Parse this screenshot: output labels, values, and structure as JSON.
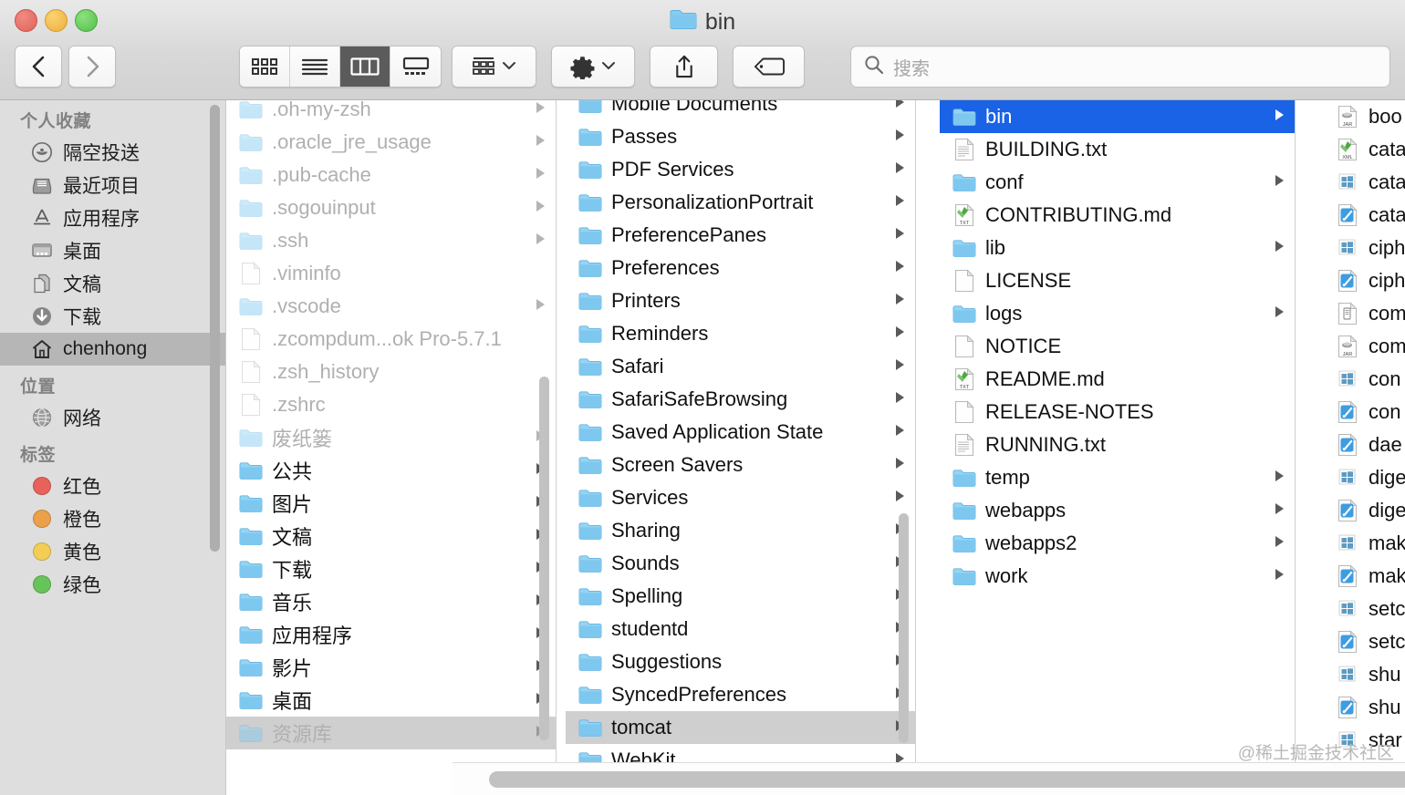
{
  "window": {
    "title": "bin",
    "title_icon": "folder-icon",
    "traffic_lights": [
      "close-button",
      "minimize-button",
      "zoom-button"
    ]
  },
  "toolbar": {
    "back_label": "‹",
    "forward_label": "›",
    "view_modes": [
      {
        "name": "icon-view",
        "label": "icon",
        "active": false
      },
      {
        "name": "list-view",
        "label": "list",
        "active": false
      },
      {
        "name": "column-view",
        "label": "column",
        "active": true
      },
      {
        "name": "gallery-view",
        "label": "gallery",
        "active": false
      }
    ],
    "arrange_label": "arrange",
    "action_label": "action",
    "share_label": "share",
    "tag_label": "tag",
    "chevron": "˅"
  },
  "search": {
    "placeholder": "搜索",
    "value": "",
    "icon": "search-icon"
  },
  "sidebar": {
    "sections": [
      {
        "title": "个人收藏",
        "items": [
          {
            "label": "隔空投送",
            "icon": "airdrop-icon",
            "selected": false
          },
          {
            "label": "最近项目",
            "icon": "recents-icon",
            "selected": false
          },
          {
            "label": "应用程序",
            "icon": "applications-icon",
            "selected": false
          },
          {
            "label": "桌面",
            "icon": "desktop-icon",
            "selected": false
          },
          {
            "label": "文稿",
            "icon": "documents-icon",
            "selected": false
          },
          {
            "label": "下载",
            "icon": "downloads-icon",
            "selected": false
          },
          {
            "label": "chenhong",
            "icon": "home-icon",
            "selected": true
          }
        ]
      },
      {
        "title": "位置",
        "items": [
          {
            "label": "网络",
            "icon": "network-icon",
            "selected": false
          }
        ]
      },
      {
        "title": "标签",
        "items": [
          {
            "label": "红色",
            "icon": "tag-dot-icon",
            "color": "#e8615a",
            "selected": false
          },
          {
            "label": "橙色",
            "icon": "tag-dot-icon",
            "color": "#eda04a",
            "selected": false
          },
          {
            "label": "黄色",
            "icon": "tag-dot-icon",
            "color": "#f2ce55",
            "selected": false
          },
          {
            "label": "绿色",
            "icon": "tag-dot-icon",
            "color": "#67c45a",
            "selected": false
          }
        ]
      }
    ]
  },
  "columns": [
    {
      "name": "home-column",
      "items": [
        {
          "label": ".oh-my-zsh",
          "kind": "folder",
          "dim": true,
          "arrow": true,
          "selected": false
        },
        {
          "label": ".oracle_jre_usage",
          "kind": "folder",
          "dim": true,
          "arrow": true,
          "selected": false
        },
        {
          "label": ".pub-cache",
          "kind": "folder",
          "dim": true,
          "arrow": true,
          "selected": false
        },
        {
          "label": ".sogouinput",
          "kind": "folder",
          "dim": true,
          "arrow": true,
          "selected": false
        },
        {
          "label": ".ssh",
          "kind": "folder",
          "dim": true,
          "arrow": true,
          "selected": false
        },
        {
          "label": ".viminfo",
          "kind": "doc",
          "dim": true,
          "arrow": false,
          "selected": false
        },
        {
          "label": ".vscode",
          "kind": "folder",
          "dim": true,
          "arrow": true,
          "selected": false
        },
        {
          "label": ".zcompdum...ok Pro-5.7.1",
          "kind": "doc",
          "dim": true,
          "arrow": false,
          "selected": false
        },
        {
          "label": ".zsh_history",
          "kind": "doc",
          "dim": true,
          "arrow": false,
          "selected": false
        },
        {
          "label": ".zshrc",
          "kind": "doc",
          "dim": true,
          "arrow": false,
          "selected": false
        },
        {
          "label": "废纸篓",
          "kind": "folder",
          "dim": true,
          "arrow": true,
          "selected": false
        },
        {
          "label": "公共",
          "kind": "folder",
          "dim": false,
          "arrow": true,
          "selected": false
        },
        {
          "label": "图片",
          "kind": "folder",
          "dim": false,
          "arrow": true,
          "selected": false
        },
        {
          "label": "文稿",
          "kind": "folder",
          "dim": false,
          "arrow": true,
          "selected": false
        },
        {
          "label": "下载",
          "kind": "folder",
          "dim": false,
          "arrow": true,
          "selected": false
        },
        {
          "label": "音乐",
          "kind": "folder",
          "dim": false,
          "arrow": true,
          "selected": false
        },
        {
          "label": "应用程序",
          "kind": "folder",
          "dim": false,
          "arrow": true,
          "selected": false
        },
        {
          "label": "影片",
          "kind": "folder",
          "dim": false,
          "arrow": true,
          "selected": false
        },
        {
          "label": "桌面",
          "kind": "folder",
          "dim": false,
          "arrow": true,
          "selected": false
        },
        {
          "label": "资源库",
          "kind": "folder",
          "dim": true,
          "arrow": true,
          "selected": "grey"
        }
      ]
    },
    {
      "name": "library-column",
      "items": [
        {
          "label": "Mobile Documents",
          "kind": "folder",
          "dim": false,
          "arrow": true,
          "selected": false
        },
        {
          "label": "Passes",
          "kind": "folder",
          "dim": false,
          "arrow": true,
          "selected": false
        },
        {
          "label": "PDF Services",
          "kind": "folder",
          "dim": false,
          "arrow": true,
          "selected": false
        },
        {
          "label": "PersonalizationPortrait",
          "kind": "folder",
          "dim": false,
          "arrow": true,
          "selected": false
        },
        {
          "label": "PreferencePanes",
          "kind": "folder",
          "dim": false,
          "arrow": true,
          "selected": false
        },
        {
          "label": "Preferences",
          "kind": "folder",
          "dim": false,
          "arrow": true,
          "selected": false
        },
        {
          "label": "Printers",
          "kind": "folder",
          "dim": false,
          "arrow": true,
          "selected": false
        },
        {
          "label": "Reminders",
          "kind": "folder",
          "dim": false,
          "arrow": true,
          "selected": false
        },
        {
          "label": "Safari",
          "kind": "folder",
          "dim": false,
          "arrow": true,
          "selected": false
        },
        {
          "label": "SafariSafeBrowsing",
          "kind": "folder",
          "dim": false,
          "arrow": true,
          "selected": false
        },
        {
          "label": "Saved Application State",
          "kind": "folder",
          "dim": false,
          "arrow": true,
          "selected": false
        },
        {
          "label": "Screen Savers",
          "kind": "folder",
          "dim": false,
          "arrow": true,
          "selected": false
        },
        {
          "label": "Services",
          "kind": "folder",
          "dim": false,
          "arrow": true,
          "selected": false
        },
        {
          "label": "Sharing",
          "kind": "folder",
          "dim": false,
          "arrow": true,
          "selected": false
        },
        {
          "label": "Sounds",
          "kind": "folder",
          "dim": false,
          "arrow": true,
          "selected": false
        },
        {
          "label": "Spelling",
          "kind": "folder",
          "dim": false,
          "arrow": true,
          "selected": false
        },
        {
          "label": "studentd",
          "kind": "folder",
          "dim": false,
          "arrow": true,
          "selected": false
        },
        {
          "label": "Suggestions",
          "kind": "folder",
          "dim": false,
          "arrow": true,
          "selected": false
        },
        {
          "label": "SyncedPreferences",
          "kind": "folder",
          "dim": false,
          "arrow": true,
          "selected": false
        },
        {
          "label": "tomcat",
          "kind": "folder",
          "dim": false,
          "arrow": true,
          "selected": "grey"
        },
        {
          "label": "WebKit",
          "kind": "folder",
          "dim": false,
          "arrow": true,
          "selected": false
        }
      ]
    },
    {
      "name": "tomcat-column",
      "items": [
        {
          "label": "bin",
          "kind": "folder",
          "dim": false,
          "arrow": true,
          "selected": "blue"
        },
        {
          "label": "BUILDING.txt",
          "kind": "textdoc",
          "dim": false,
          "arrow": false,
          "selected": false
        },
        {
          "label": "conf",
          "kind": "folder",
          "dim": false,
          "arrow": true,
          "selected": false
        },
        {
          "label": "CONTRIBUTING.md",
          "kind": "txtbadge",
          "dim": false,
          "arrow": false,
          "selected": false
        },
        {
          "label": "lib",
          "kind": "folder",
          "dim": false,
          "arrow": true,
          "selected": false
        },
        {
          "label": "LICENSE",
          "kind": "doc",
          "dim": false,
          "arrow": false,
          "selected": false
        },
        {
          "label": "logs",
          "kind": "folder",
          "dim": false,
          "arrow": true,
          "selected": false
        },
        {
          "label": "NOTICE",
          "kind": "doc",
          "dim": false,
          "arrow": false,
          "selected": false
        },
        {
          "label": "README.md",
          "kind": "txtbadge",
          "dim": false,
          "arrow": false,
          "selected": false
        },
        {
          "label": "RELEASE-NOTES",
          "kind": "doc",
          "dim": false,
          "arrow": false,
          "selected": false
        },
        {
          "label": "RUNNING.txt",
          "kind": "textdoc",
          "dim": false,
          "arrow": false,
          "selected": false
        },
        {
          "label": "temp",
          "kind": "folder",
          "dim": false,
          "arrow": true,
          "selected": false
        },
        {
          "label": "webapps",
          "kind": "folder",
          "dim": false,
          "arrow": true,
          "selected": false
        },
        {
          "label": "webapps2",
          "kind": "folder",
          "dim": false,
          "arrow": true,
          "selected": false
        },
        {
          "label": "work",
          "kind": "folder",
          "dim": false,
          "arrow": true,
          "selected": false
        }
      ]
    },
    {
      "name": "bin-column",
      "items": [
        {
          "label": "boo",
          "kind": "jar",
          "dim": false,
          "arrow": false,
          "selected": false
        },
        {
          "label": "cata",
          "kind": "xml",
          "dim": false,
          "arrow": false,
          "selected": false
        },
        {
          "label": "cata",
          "kind": "bat",
          "dim": false,
          "arrow": false,
          "selected": false
        },
        {
          "label": "cata",
          "kind": "sh",
          "dim": false,
          "arrow": false,
          "selected": false
        },
        {
          "label": "ciph",
          "kind": "bat",
          "dim": false,
          "arrow": false,
          "selected": false
        },
        {
          "label": "ciph",
          "kind": "sh",
          "dim": false,
          "arrow": false,
          "selected": false
        },
        {
          "label": "com",
          "kind": "exec",
          "dim": false,
          "arrow": false,
          "selected": false
        },
        {
          "label": "com",
          "kind": "jar",
          "dim": false,
          "arrow": false,
          "selected": false
        },
        {
          "label": "con",
          "kind": "bat",
          "dim": false,
          "arrow": false,
          "selected": false
        },
        {
          "label": "con",
          "kind": "sh",
          "dim": false,
          "arrow": false,
          "selected": false
        },
        {
          "label": "dae",
          "kind": "sh",
          "dim": false,
          "arrow": false,
          "selected": false
        },
        {
          "label": "dige",
          "kind": "bat",
          "dim": false,
          "arrow": false,
          "selected": false
        },
        {
          "label": "dige",
          "kind": "sh",
          "dim": false,
          "arrow": false,
          "selected": false
        },
        {
          "label": "mak",
          "kind": "bat",
          "dim": false,
          "arrow": false,
          "selected": false
        },
        {
          "label": "mak",
          "kind": "sh",
          "dim": false,
          "arrow": false,
          "selected": false
        },
        {
          "label": "setc",
          "kind": "bat",
          "dim": false,
          "arrow": false,
          "selected": false
        },
        {
          "label": "setc",
          "kind": "sh",
          "dim": false,
          "arrow": false,
          "selected": false
        },
        {
          "label": "shu",
          "kind": "bat",
          "dim": false,
          "arrow": false,
          "selected": false
        },
        {
          "label": "shu",
          "kind": "sh",
          "dim": false,
          "arrow": false,
          "selected": false
        },
        {
          "label": "star",
          "kind": "bat",
          "dim": false,
          "arrow": false,
          "selected": false
        }
      ]
    }
  ],
  "watermark": "@稀土掘金技术社区",
  "colors": {
    "selection_blue": "#1a62e6",
    "selection_grey": "#cfcfcf",
    "folder_blue": "#7ec8f0",
    "toolbar_bg": "#d8d8d8",
    "sidebar_bg": "#dededf"
  }
}
